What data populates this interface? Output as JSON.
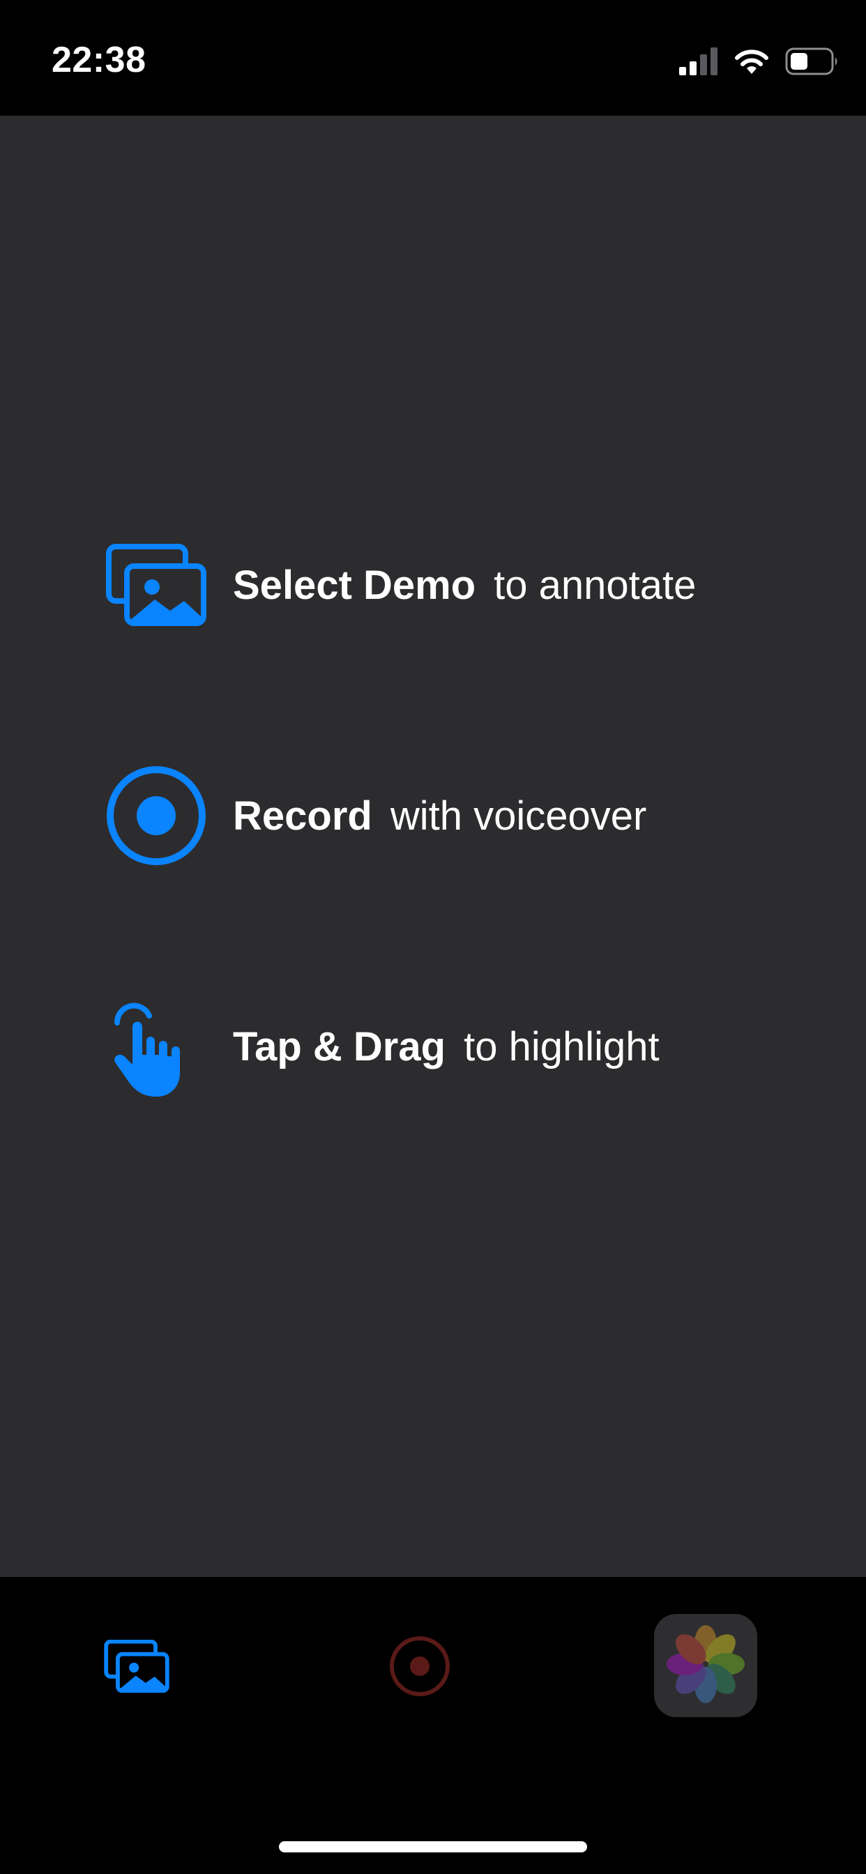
{
  "status_bar": {
    "time": "22:38",
    "icons": [
      "cellular-signal-icon",
      "wifi-icon",
      "battery-icon"
    ]
  },
  "onboarding": [
    {
      "icon": "photo-stack-icon",
      "action": "Select Demo",
      "description": "to annotate"
    },
    {
      "icon": "record-icon",
      "action": "Record",
      "description": "with voiceover"
    },
    {
      "icon": "tap-drag-hand-icon",
      "action": "Tap & Drag",
      "description": "to highlight"
    }
  ],
  "tab_bar": {
    "items": [
      {
        "icon": "photo-stack-icon",
        "state": "active"
      },
      {
        "icon": "record-icon",
        "state": "disabled"
      },
      {
        "icon": "photos-app-icon",
        "state": "disabled"
      }
    ]
  },
  "colors": {
    "accent": "#0a84ff",
    "content_bg": "#2c2c2e",
    "bar_bg": "#000000",
    "text": "#ffffff",
    "record_disabled": "#5a1a17"
  }
}
